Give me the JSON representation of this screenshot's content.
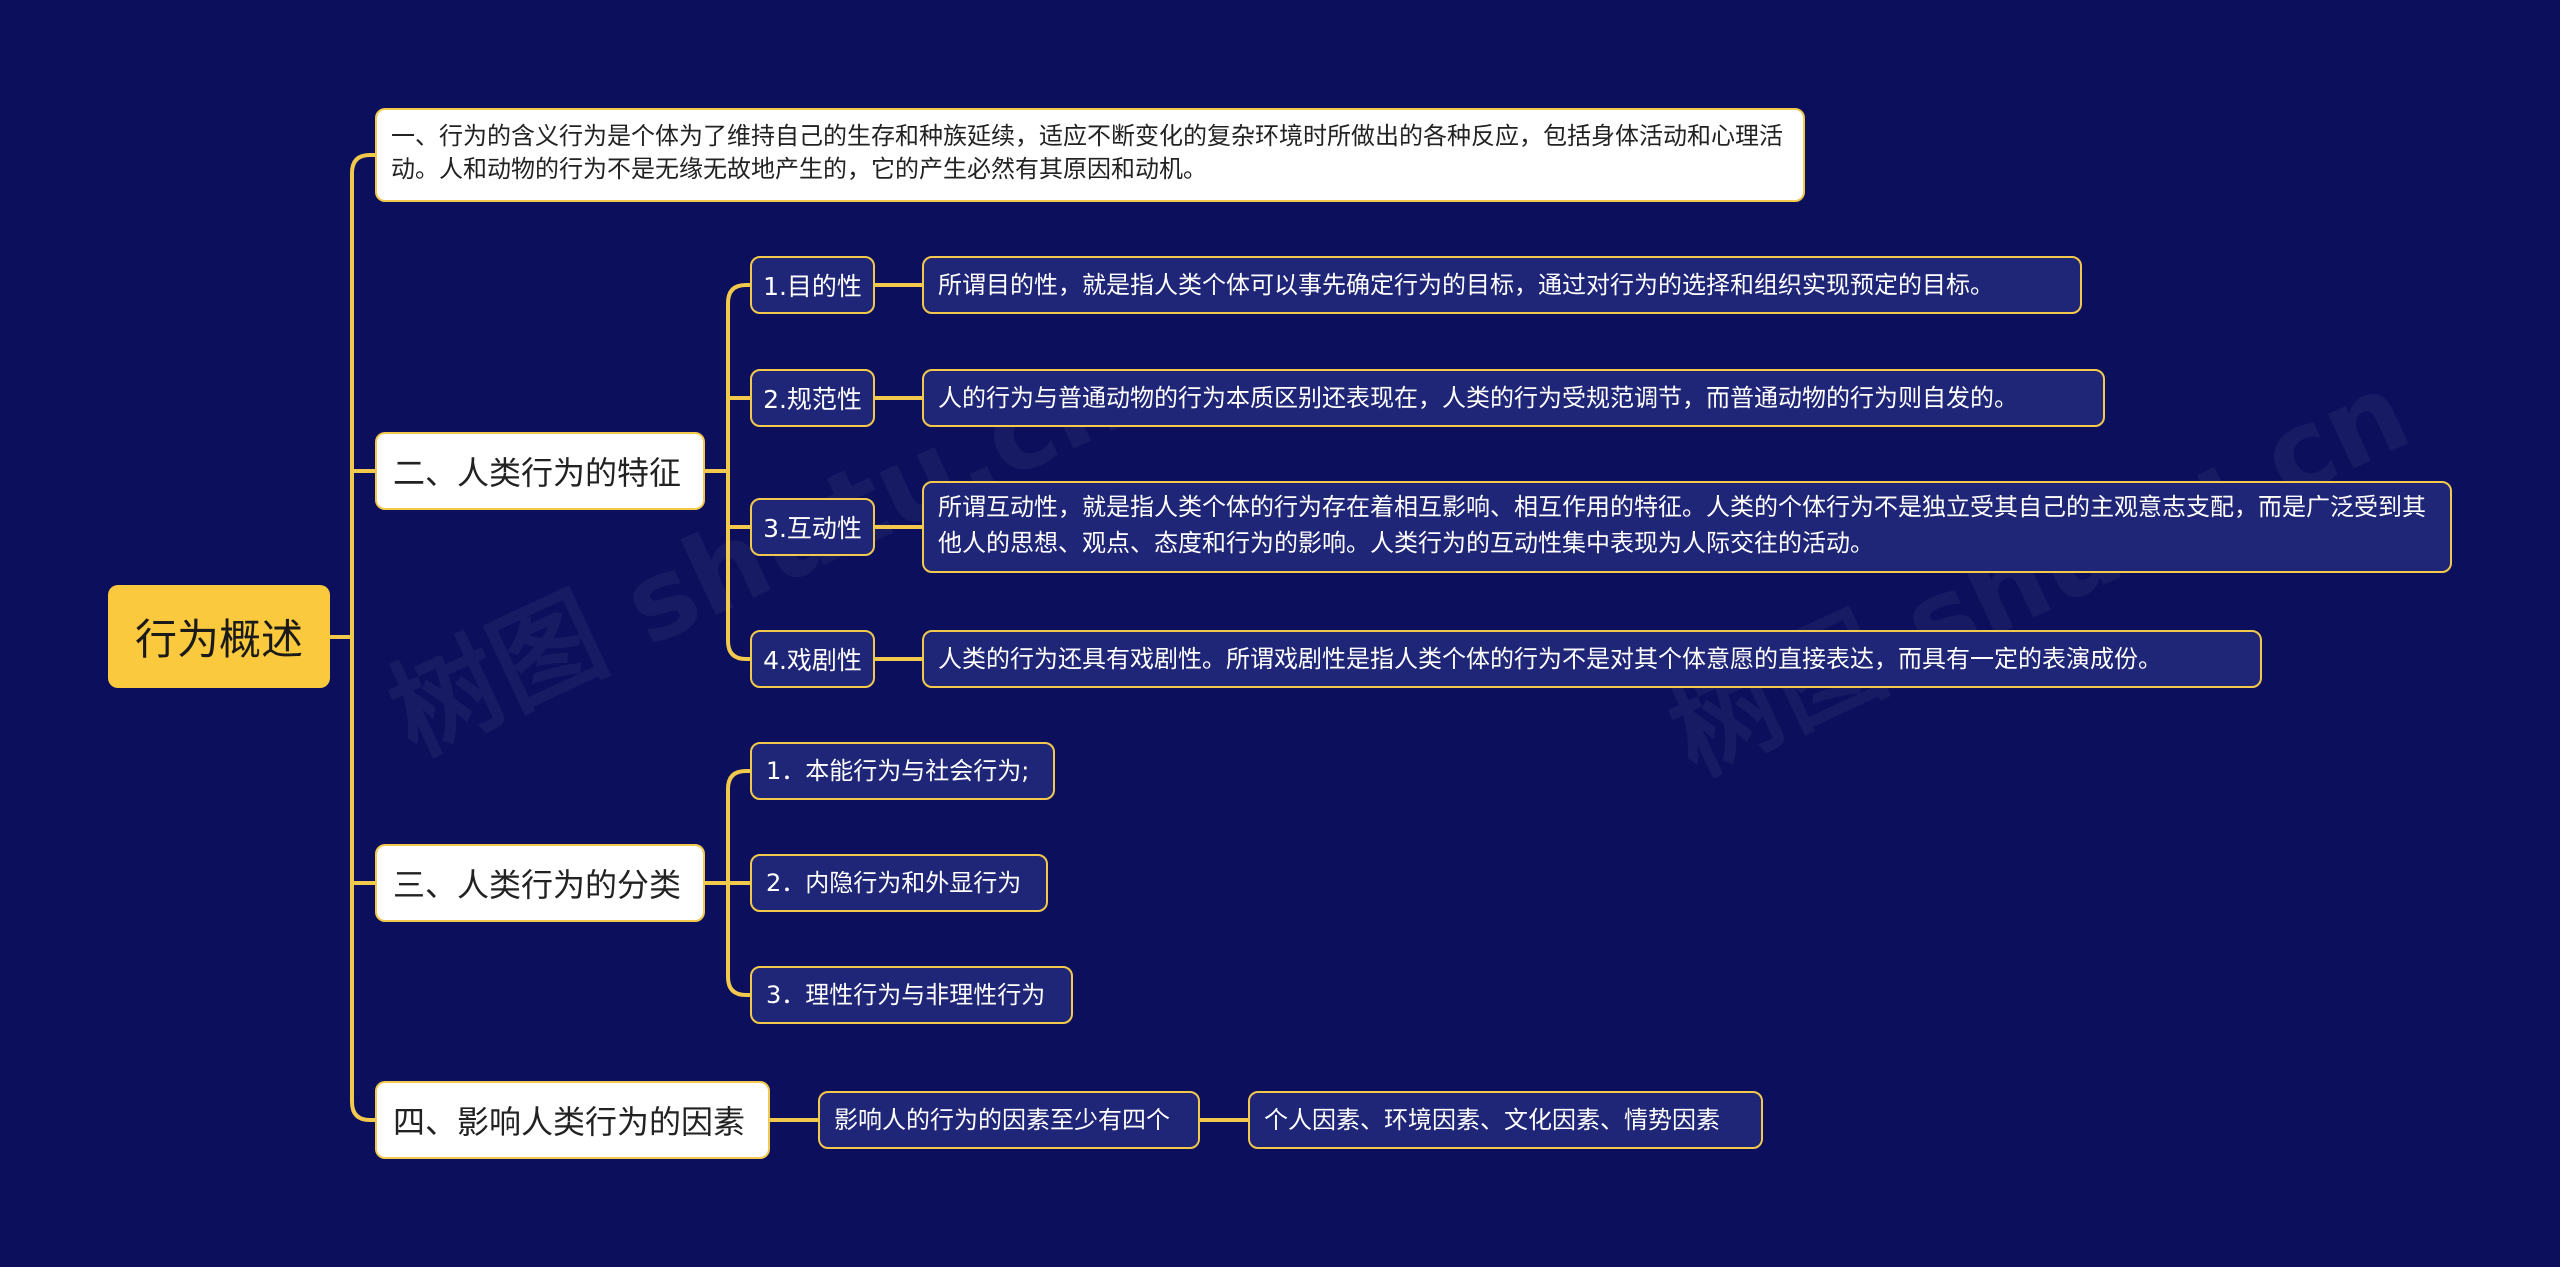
{
  "watermark": [
    "树图 shutu.cn",
    "树图 shutu.cn"
  ],
  "colors": {
    "background": "#0b0f5c",
    "root": "#fbc93d",
    "line": "#f2c94c",
    "dark_node": "#1f2577"
  },
  "root": {
    "label": "行为概述"
  },
  "section1": {
    "text": "一、行为的含义行为是个体为了维持自己的生存和种族延续，适应不断变化的复杂环境时所做出的各种反应，包括身体活动和心理活动。人和动物的行为不是无缘无故地产生的，它的产生必然有其原因和动机。"
  },
  "section2": {
    "title": "二、人类行为的特征",
    "items": [
      {
        "tag": "1.目的性",
        "desc": "所谓目的性，就是指人类个体可以事先确定行为的目标，通过对行为的选择和组织实现预定的目标。"
      },
      {
        "tag": "2.规范性",
        "desc": "人的行为与普通动物的行为本质区别还表现在，人类的行为受规范调节，而普通动物的行为则自发的。"
      },
      {
        "tag": "3.互动性",
        "desc": "所谓互动性，就是指人类个体的行为存在着相互影响、相互作用的特征。人类的个体行为不是独立受其自己的主观意志支配，而是广泛受到其他人的思想、观点、态度和行为的影响。人类行为的互动性集中表现为人际交往的活动。"
      },
      {
        "tag": "4.戏剧性",
        "desc": "人类的行为还具有戏剧性。所谓戏剧性是指人类个体的行为不是对其个体意愿的直接表达，而具有一定的表演成份。"
      }
    ]
  },
  "section3": {
    "title": "三、人类行为的分类",
    "items": [
      "1．本能行为与社会行为;",
      "2．内隐行为和外显行为",
      "3．理性行为与非理性行为"
    ]
  },
  "section4": {
    "title": "四、影响人类行为的因素",
    "child": "影响人的行为的因素至少有四个",
    "grandchild": "个人因素、环境因素、文化因素、情势因素"
  }
}
